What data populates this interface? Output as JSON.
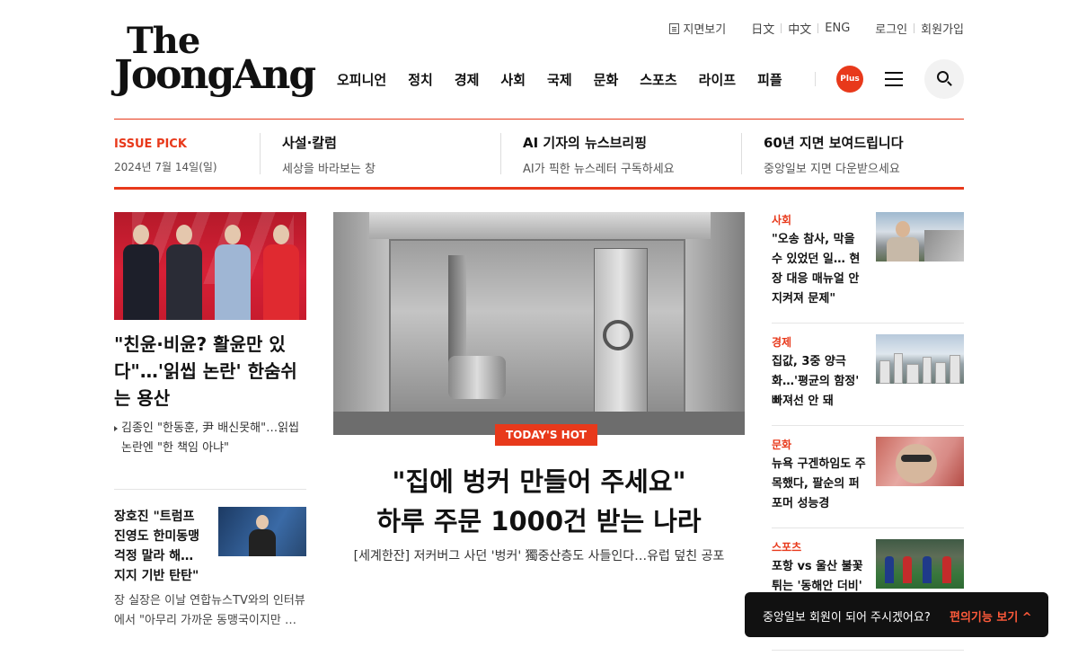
{
  "logo": {
    "line1": "The",
    "line2": "JoongAng"
  },
  "util": {
    "paper": "지면보기",
    "lang_jp": "日文",
    "lang_cn": "中文",
    "lang_en": "ENG",
    "login": "로그인",
    "join": "회원가입"
  },
  "nav": {
    "items": [
      "오피니언",
      "정치",
      "경제",
      "사회",
      "국제",
      "문화",
      "스포츠",
      "라이프",
      "피플"
    ],
    "plus": "Plus"
  },
  "issue_pick": {
    "label": "ISSUE PICK",
    "date": "2024년 7월 14일(일)",
    "items": [
      {
        "title": "사설·칼럼",
        "sub": "세상을 바라보는 창"
      },
      {
        "title": "AI 기자의 뉴스브리핑",
        "sub": "AI가 픽한 뉴스레터 구독하세요"
      },
      {
        "title": "60년 지면 보여드립니다",
        "sub": "중앙일보 지면 다운받으세요"
      }
    ]
  },
  "lead": {
    "title": "\"친윤·비윤? 활윤만 있다\"…'읽씹 논란' 한숨쉬는 용산",
    "sub": "김종인 \"한동훈, 尹 배신못해\"…읽씹 논란엔 \"한 책임 아냐\""
  },
  "second": {
    "title": "장호진 \"트럼프 진영도 한미동맹 걱정 말라 해… 지지 기반 탄탄\"",
    "sub": "장 실장은 이날 연합뉴스TV와의 인터뷰에서 \"아무리 가까운 동맹국이지만 …"
  },
  "main": {
    "badge": "TODAY'S HOT",
    "title1": "\"집에 벙커 만들어 주세요\"",
    "title2": "하루 주문 1000건 받는 나라",
    "sub": "[세계한잔] 저커버그 사던 '벙커' 獨중산층도 사들인다…유럽 덮친 공포"
  },
  "side": [
    {
      "category": "사회",
      "title": "\"오송 참사, 막을 수 있었던 일… 현장 대응 매뉴얼 안 지켜져 문제\""
    },
    {
      "category": "경제",
      "title": "집값, 3중 양극화…'평균의 함정' 빠져선 안 돼"
    },
    {
      "category": "문화",
      "title": "뉴욕 구겐하임도 주목했다, 팔순의 퍼포머 성능경"
    },
    {
      "category": "스포츠",
      "title": "포항 vs 울산 불꽃 튀는 '동해안 더비'"
    }
  ],
  "toast": {
    "message": "중앙일보 회원이 되어 주시겠어요?",
    "action": "편의기능 보기 ^"
  },
  "colors": {
    "accent": "#e8391b",
    "toast_bg": "#111111"
  }
}
